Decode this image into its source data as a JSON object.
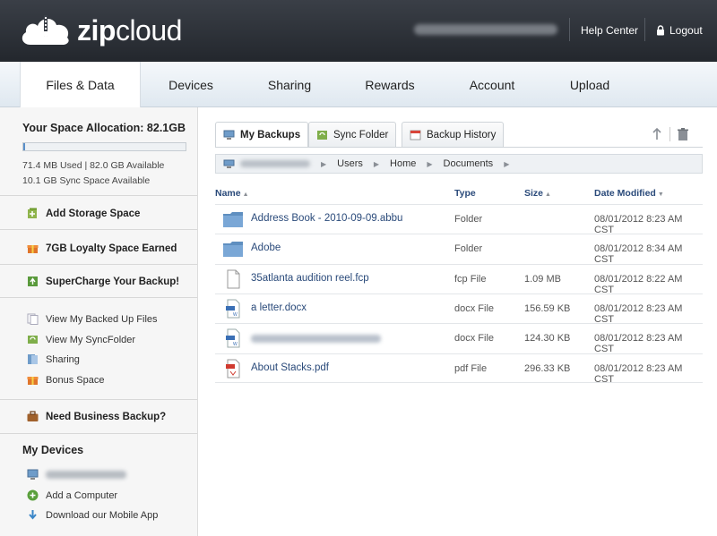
{
  "header": {
    "logo_bold": "zip",
    "logo_light": "cloud",
    "help_label": "Help Center",
    "logout_label": "Logout"
  },
  "nav": {
    "tabs": [
      {
        "label": "Files & Data",
        "active": true
      },
      {
        "label": "Devices"
      },
      {
        "label": "Sharing"
      },
      {
        "label": "Rewards"
      },
      {
        "label": "Account"
      },
      {
        "label": "Upload"
      }
    ]
  },
  "sidebar": {
    "space_title": "Your Space Allocation: 82.1GB",
    "space_used_fraction": 0.01,
    "space_used_line": "71.4 MB Used | 82.0 GB Available",
    "sync_space_line": "10.1 GB Sync Space Available",
    "add_storage": "Add Storage Space",
    "loyalty": "7GB Loyalty Space Earned",
    "supercharge": "SuperCharge Your Backup!",
    "links": [
      {
        "label": "View My Backed Up Files",
        "icon": "files-icon"
      },
      {
        "label": "View My SyncFolder",
        "icon": "sync-icon"
      },
      {
        "label": "Sharing",
        "icon": "share-icon"
      },
      {
        "label": "Bonus Space",
        "icon": "gift-icon"
      }
    ],
    "business": "Need Business Backup?",
    "my_devices_title": "My Devices",
    "device_links": [
      {
        "label": "Add a Computer",
        "icon": "add-icon"
      },
      {
        "label": "Download our Mobile App",
        "icon": "download-icon"
      }
    ]
  },
  "main": {
    "subtabs": [
      {
        "label": "My Backups",
        "active": true
      },
      {
        "label": "Sync Folder"
      },
      {
        "label": "Backup History"
      }
    ],
    "breadcrumbs": [
      "Users",
      "Home",
      "Documents"
    ],
    "columns": {
      "name": "Name",
      "type": "Type",
      "size": "Size",
      "date": "Date Modified"
    },
    "files": [
      {
        "name": "Address Book - 2010-09-09.abbu",
        "type": "Folder",
        "size": "",
        "date": "08/01/2012 8:23 AM CST",
        "icon": "folder-icon"
      },
      {
        "name": "Adobe",
        "type": "Folder",
        "size": "",
        "date": "08/01/2012 8:34 AM CST",
        "icon": "folder-icon"
      },
      {
        "name": "35atlanta audition reel.fcp",
        "type": "fcp File",
        "size": "1.09 MB",
        "date": "08/01/2012 8:22 AM CST",
        "icon": "file-icon"
      },
      {
        "name": "a letter.docx",
        "type": "docx File",
        "size": "156.59 KB",
        "date": "08/01/2012 8:23 AM CST",
        "icon": "docx-icon"
      },
      {
        "name": "",
        "type": "docx File",
        "size": "124.30 KB",
        "date": "08/01/2012 8:23 AM CST",
        "icon": "docx-icon"
      },
      {
        "name": "About Stacks.pdf",
        "type": "pdf File",
        "size": "296.33 KB",
        "date": "08/01/2012 8:23 AM CST",
        "icon": "pdf-icon"
      }
    ]
  },
  "colors": {
    "header_bg": "#2c3036",
    "link_blue": "#2a4a7a",
    "folder_blue": "#6f9cc9",
    "space_fill": "#5a8fc9"
  }
}
